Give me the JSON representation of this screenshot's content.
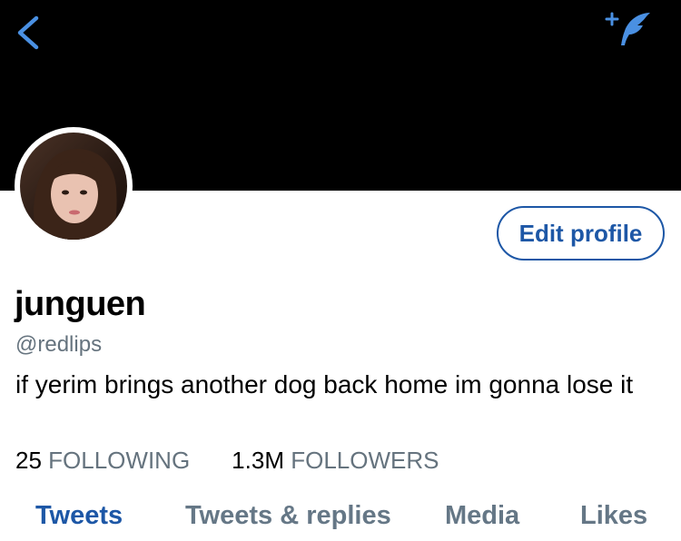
{
  "profile": {
    "display_name": "junguen",
    "handle": "@redlips",
    "bio": "if yerim brings another dog back home im gonna lose it"
  },
  "actions": {
    "edit_profile_label": "Edit profile"
  },
  "stats": {
    "following_count": "25",
    "following_label": "FOLLOWING",
    "followers_count": "1.3M",
    "followers_label": "FOLLOWERS"
  },
  "tabs": [
    {
      "label": "Tweets",
      "active": true
    },
    {
      "label": "Tweets & replies",
      "active": false
    },
    {
      "label": "Media",
      "active": false
    },
    {
      "label": "Likes",
      "active": false
    }
  ],
  "colors": {
    "accent": "#1d57a6",
    "icon_blue": "#4a90e2",
    "secondary_text": "#65737e",
    "header_bg": "#000000"
  },
  "icons": {
    "back": "chevron-left-icon",
    "compose": "quill-plus-icon"
  }
}
